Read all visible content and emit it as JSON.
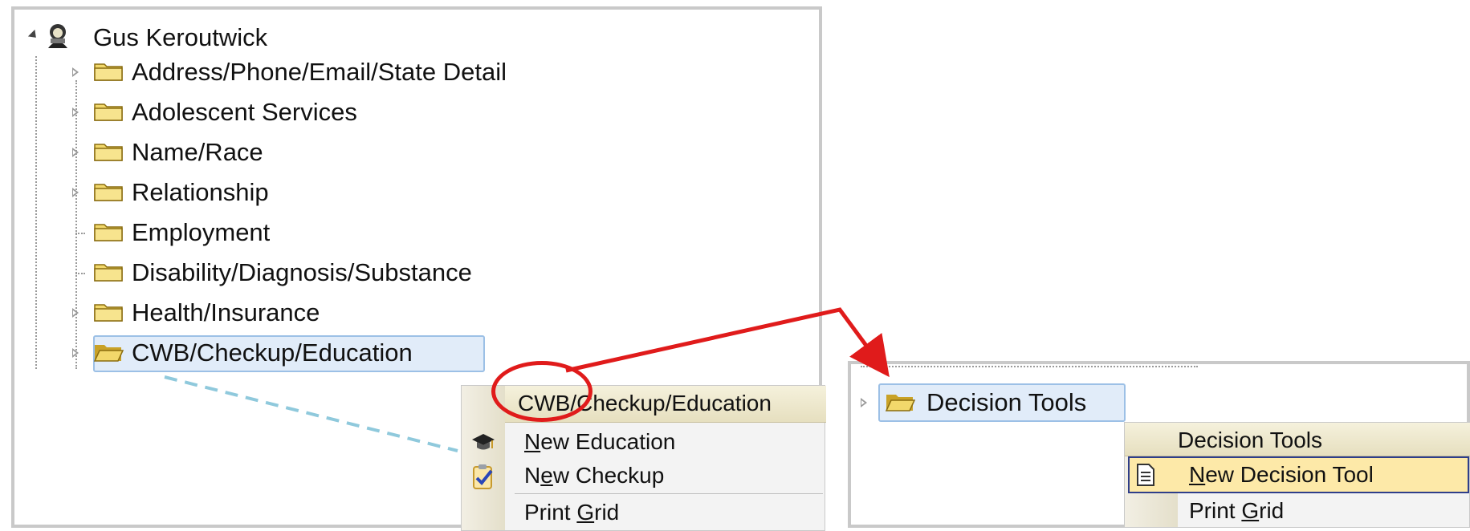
{
  "left_tree": {
    "root": {
      "label": "Gus Keroutwick",
      "icon": "user-icon"
    },
    "children": [
      {
        "label": "Address/Phone/Email/State Detail",
        "expandable": true
      },
      {
        "label": "Adolescent Services",
        "expandable": true
      },
      {
        "label": "Name/Race",
        "expandable": true
      },
      {
        "label": "Relationship",
        "expandable": true
      },
      {
        "label": "Employment",
        "expandable": false
      },
      {
        "label": "Disability/Diagnosis/Substance",
        "expandable": false
      },
      {
        "label": "Health/Insurance",
        "expandable": true
      },
      {
        "label": "CWB/Checkup/Education",
        "expandable": true,
        "selected": true
      }
    ]
  },
  "left_menu": {
    "header": "CWB/Checkup/Education",
    "items": [
      {
        "pre": "",
        "u": "N",
        "post": "ew Education",
        "icon": "graduation-cap-icon"
      },
      {
        "pre": "N",
        "u": "e",
        "post": "w Checkup",
        "icon": "checklist-icon"
      },
      {
        "pre": "Print ",
        "u": "G",
        "post": "rid",
        "icon": ""
      }
    ]
  },
  "right_tree": {
    "node": {
      "label": "Decision Tools",
      "selected": true
    }
  },
  "right_menu": {
    "header": "Decision Tools",
    "items": [
      {
        "pre": "",
        "u": "N",
        "post": "ew Decision Tool",
        "icon": "document-icon",
        "highlighted": true
      },
      {
        "pre": "Print ",
        "u": "G",
        "post": "rid",
        "icon": ""
      }
    ]
  },
  "colors": {
    "annotation_red": "#e01b1b",
    "folder_yellow": "#f2d86b",
    "selection_blue": "#e1ecf9",
    "menu_highlight": "#fde9a8"
  }
}
